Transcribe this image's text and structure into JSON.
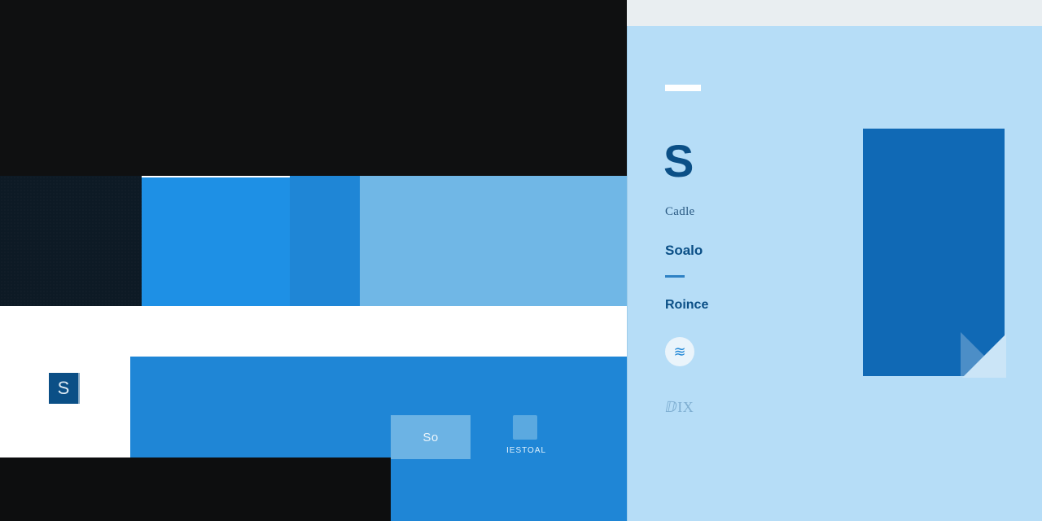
{
  "left": {
    "mini_swatch_letter": "S",
    "pill_label": "So",
    "chip_label": "IESTOAL"
  },
  "panel": {
    "logo_letter": "S",
    "items": [
      {
        "label": "Cadle"
      },
      {
        "label": "Soalo"
      },
      {
        "label": "Roince"
      }
    ],
    "icon_glyph": "≋",
    "muted_text": "ⅅIX"
  },
  "colors": {
    "dark": "#0f1011",
    "navy_texture": "#0d1a25",
    "bright_blue": "#1e90e5",
    "mid_blue": "#1f86d6",
    "light_blue_band": "#70b7e6",
    "panel_bg": "#b6ddf7",
    "poster_blue": "#1069b5",
    "deep_brand": "#0b4f86"
  }
}
